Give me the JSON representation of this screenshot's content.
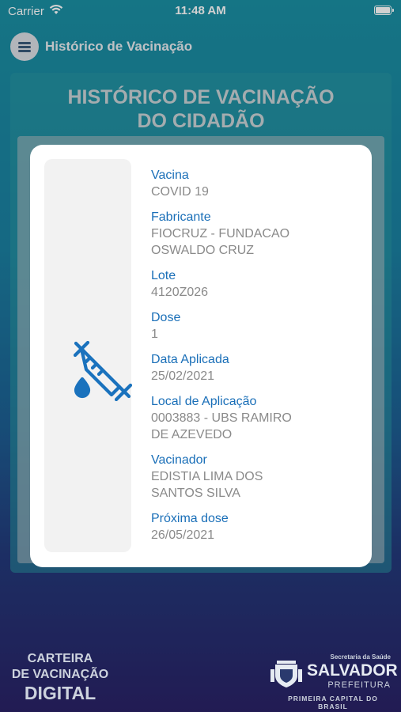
{
  "status_bar": {
    "carrier": "Carrier",
    "time": "11:48 AM",
    "battery_level": 1.0
  },
  "header": {
    "menu_icon": "hamburger-menu-icon",
    "title": "Histórico de Vacinação"
  },
  "background_panel": {
    "title_line1": "HISTÓRICO DE VACINAÇÃO",
    "title_line2": "DO CIDADÃO"
  },
  "modal": {
    "icon": "syringe-icon",
    "fields": [
      {
        "label": "Vacina",
        "value_lines": [
          "COVID 19"
        ]
      },
      {
        "label": "Fabricante",
        "value_lines": [
          "FIOCRUZ - FUNDACAO",
          "OSWALDO CRUZ"
        ]
      },
      {
        "label": "Lote",
        "value_lines": [
          "4120Z026"
        ]
      },
      {
        "label": "Dose",
        "value_lines": [
          "1"
        ]
      },
      {
        "label": "Data Aplicada",
        "value_lines": [
          "25/02/2021"
        ]
      },
      {
        "label": "Local de Aplicação",
        "value_lines": [
          "0003883 - UBS RAMIRO",
          "DE AZEVEDO"
        ]
      },
      {
        "label": "Vacinador",
        "value_lines": [
          "EDISTIA LIMA DOS",
          "SANTOS SILVA"
        ]
      },
      {
        "label": "Próxima dose",
        "value_lines": [
          "26/05/2021"
        ]
      }
    ]
  },
  "footer": {
    "app_name_line1": "CARTEIRA",
    "app_name_line2": "DE VACINAÇÃO",
    "app_name_line3": "DIGITAL",
    "logo_secretaria": "Secretaria da Saúde",
    "logo_salvador": "SALVADOR",
    "logo_prefeitura": "PREFEITURA",
    "logo_capital": "PRIMEIRA CAPITAL DO BRASIL"
  },
  "colors": {
    "label_blue": "#1a6fb8",
    "value_gray": "#8a8a8a",
    "syringe_blue": "#1a72bd"
  }
}
